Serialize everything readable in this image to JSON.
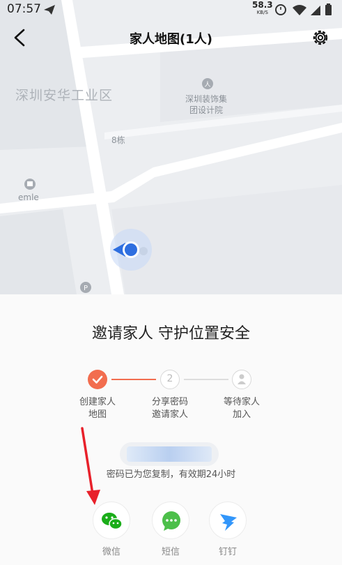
{
  "status_bar": {
    "time": "07:57",
    "speed_value": "58.3",
    "speed_unit": "KB/S"
  },
  "header": {
    "title": "家人地图(1人)",
    "back_icon": "chevron-left-icon",
    "settings_icon": "gear-icon"
  },
  "map": {
    "district_label": "深圳安华工业区",
    "poi_label_line1": "深圳装饰集",
    "poi_label_line2": "团设计院",
    "building_label": "8栋",
    "shop_label": "emle"
  },
  "invite": {
    "headline": "邀请家人 守护位置安全",
    "steps": [
      {
        "line1": "创建家人",
        "line2": "地图",
        "state": "done"
      },
      {
        "line1": "分享密码",
        "line2": "邀请家人",
        "number": "2",
        "state": "pending"
      },
      {
        "line1": "等待家人",
        "line2": "加入",
        "state": "pending"
      }
    ],
    "password_value": "",
    "copied_note": "密码已为您复制，有效期24小时",
    "share_options": [
      {
        "label": "微信",
        "icon": "wechat-icon",
        "color": "#1aad19"
      },
      {
        "label": "短信",
        "icon": "sms-chat-icon",
        "color": "#4cbf4a"
      },
      {
        "label": "钉钉",
        "icon": "dingtalk-icon",
        "color": "#3296fa"
      }
    ]
  },
  "colors": {
    "accent": "#f26d4f",
    "location_dot": "#2f6fe0"
  }
}
